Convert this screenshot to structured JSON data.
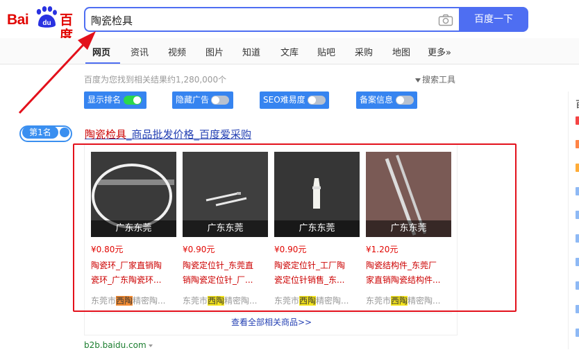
{
  "logo": {
    "text_bai": "Bai",
    "text_du": "du",
    "text_cn": "百度"
  },
  "search": {
    "value": "陶瓷检具",
    "button_label": "百度一下"
  },
  "nav": {
    "tabs": [
      {
        "label": "网页",
        "active": true
      },
      {
        "label": "资讯"
      },
      {
        "label": "视频"
      },
      {
        "label": "图片"
      },
      {
        "label": "知道"
      },
      {
        "label": "文库"
      },
      {
        "label": "贴吧"
      },
      {
        "label": "采购"
      },
      {
        "label": "地图"
      },
      {
        "label": "更多»"
      }
    ]
  },
  "stats": {
    "text": "百度为您找到相关结果约1,280,000个",
    "tools_label": "搜索工具"
  },
  "toggles": [
    {
      "label": "显示排名",
      "on": true
    },
    {
      "label": "隐藏广告",
      "on": false
    },
    {
      "label": "SEO难易度",
      "on": false
    },
    {
      "label": "备案信息",
      "on": false
    }
  ],
  "rank": {
    "label": "第1名"
  },
  "result": {
    "title_highlight": "陶瓷检具",
    "title_rest": "_商品批发价格_百度爱采购",
    "see_all": "查看全部相关商品>>",
    "site": "b2b.baidu.com"
  },
  "products": [
    {
      "place": "广东东莞",
      "price": "¥0.80元",
      "name_line1": "陶瓷环_厂家直销陶",
      "name_line2": "瓷环_广东陶瓷环...",
      "shop_pre": "东莞市",
      "shop_hl": "西陶",
      "shop_post": "精密陶...",
      "hl_style": "orange"
    },
    {
      "place": "广东东莞",
      "price": "¥0.90元",
      "name_line1": "陶瓷定位针_东莞直",
      "name_line2": "销陶瓷定位针_厂...",
      "shop_pre": "东莞市",
      "shop_hl": "西陶",
      "shop_post": "精密陶...",
      "hl_style": "yellow"
    },
    {
      "place": "广东东莞",
      "price": "¥0.90元",
      "name_line1": "陶瓷定位针_工厂陶",
      "name_line2": "瓷定位针销售_东...",
      "shop_pre": "东莞市",
      "shop_hl": "西陶",
      "shop_post": "精密陶...",
      "hl_style": "yellow"
    },
    {
      "place": "广东东莞",
      "price": "¥1.20元",
      "name_line1": "陶瓷结构件_东莞厂",
      "name_line2": "家直销陶瓷结构件...",
      "shop_pre": "东莞市",
      "shop_hl": "西陶",
      "shop_post": "精密陶...",
      "hl_style": "yellow"
    }
  ],
  "right_panel": {
    "title": "百"
  },
  "colors": {
    "accent": "#4e6ef2",
    "annotation": "#e3101b",
    "link": "#2440b3",
    "highlight": "#c00"
  }
}
